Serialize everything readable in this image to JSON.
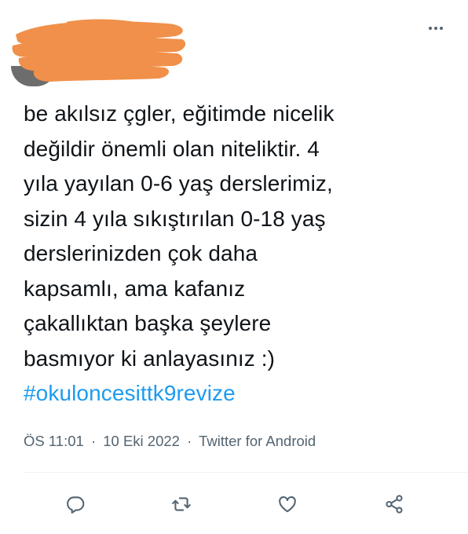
{
  "tweet": {
    "more_icon": "more-horizontal-icon",
    "text_lines": [
      "be akılsız çgler, eğitimde nicelik",
      "değildir önemli olan niteliktir. 4",
      "yıla yayılan 0-6 yaş derslerimiz,",
      "sizin 4 yıla sıkıştırılan 0-18 yaş",
      "derslerinizden çok daha",
      "kapsamlı, ama kafanız",
      "çakallıktan başka şeylere",
      "basmıyor ki anlayasınız :)"
    ],
    "hashtag": "#okuloncesittk9revize",
    "time": "ÖS 11:01",
    "date": "10 Eki 2022",
    "source": "Twitter for Android",
    "separator": "·",
    "colors": {
      "text": "#0f1419",
      "muted": "#536471",
      "link": "#1d9bf0",
      "redaction": "#f0904a"
    },
    "actions": [
      {
        "icon": "reply-icon"
      },
      {
        "icon": "retweet-icon"
      },
      {
        "icon": "like-icon"
      },
      {
        "icon": "share-icon"
      }
    ]
  }
}
